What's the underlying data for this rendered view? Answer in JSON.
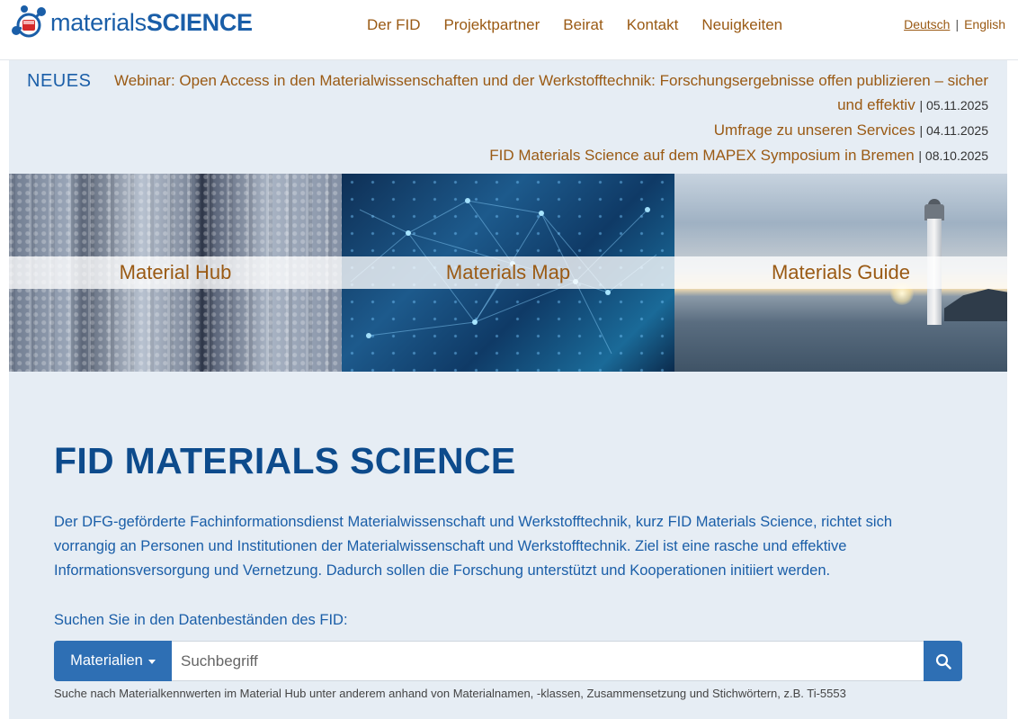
{
  "header": {
    "logo": {
      "thin": "materials",
      "bold": "SCIENCE"
    },
    "nav": [
      "Der FID",
      "Projektpartner",
      "Beirat",
      "Kontakt",
      "Neuigkeiten"
    ],
    "lang": {
      "active": "Deutsch",
      "separator": "|",
      "other": "English"
    }
  },
  "news": {
    "label": "NEUES",
    "items": [
      {
        "title": "Webinar: Open Access in den Materialwissenschaften und der Werkstofftechnik: Forschungsergebnisse offen publizieren – sicher und effektiv",
        "date": "| 05.11.2025"
      },
      {
        "title": "Umfrage zu unseren Services",
        "date": "| 04.11.2025"
      },
      {
        "title": "FID Materials Science auf dem MAPEX Symposium in Bremen",
        "date": "| 08.10.2025"
      }
    ]
  },
  "tiles": [
    {
      "label": "Material Hub"
    },
    {
      "label": "Materials Map"
    },
    {
      "label": "Materials Guide"
    }
  ],
  "main": {
    "title": "FID MATERIALS SCIENCE",
    "intro": "Der DFG-geförderte Fachinformationsdienst Materialwissenschaft und Werkstofftechnik, kurz FID Materials Science, richtet sich vorrangig an Personen und Institutionen der Materialwissenschaft und Werkstofftechnik. Ziel ist eine rasche und effektive Informationsversorgung und Vernetzung. Dadurch sollen die Forschung unterstützt und Kooperationen initiiert werden.",
    "search_label": "Suchen Sie in den Datenbeständen des FID:"
  },
  "search": {
    "dropdown_label": "Materialien",
    "placeholder": "Suchbegriff",
    "hint": "Suche nach Materialkennwerten im Material Hub unter anderem anhand von Materialnamen, -klassen, Zusammensetzung und Stichwörtern, z.B. Ti-5553"
  },
  "colors": {
    "accent": "#9a5a14",
    "primary": "#1a5ea8",
    "button": "#2e6fb4",
    "panel": "#e6edf4"
  }
}
